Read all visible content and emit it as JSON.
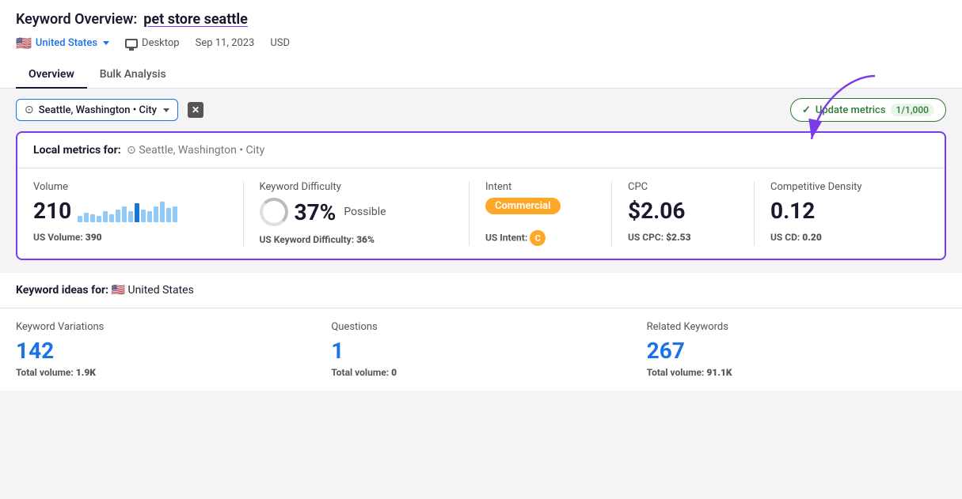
{
  "header": {
    "title_label": "Keyword Overview:",
    "title_keyword": "pet store seattle",
    "country": "United States",
    "device": "Desktop",
    "date": "Sep 11, 2023",
    "currency": "USD"
  },
  "tabs": [
    {
      "label": "Overview",
      "active": true
    },
    {
      "label": "Bulk Analysis",
      "active": false
    }
  ],
  "filter_bar": {
    "location": "Seattle, Washington",
    "location_type": "City",
    "update_button_label": "Update metrics",
    "update_count": "1/1,000"
  },
  "local_metrics": {
    "section_label": "Local metrics for:",
    "location": "Seattle, Washington",
    "location_type": "City",
    "volume": {
      "label": "Volume",
      "value": "210",
      "secondary_label": "US Volume:",
      "secondary_value": "390",
      "bars": [
        2,
        3,
        4,
        3,
        5,
        4,
        6,
        7,
        5,
        8,
        6,
        5,
        7,
        9,
        6,
        7
      ]
    },
    "keyword_difficulty": {
      "label": "Keyword Difficulty",
      "value": "37%",
      "qualifier": "Possible",
      "secondary_label": "US Keyword Difficulty:",
      "secondary_value": "36%"
    },
    "intent": {
      "label": "Intent",
      "value": "Commercial",
      "secondary_label": "US Intent:",
      "secondary_value": "C"
    },
    "cpc": {
      "label": "CPC",
      "value": "$2.06",
      "secondary_label": "US CPC:",
      "secondary_value": "$2.53"
    },
    "competitive_density": {
      "label": "Competitive Density",
      "value": "0.12",
      "secondary_label": "US CD:",
      "secondary_value": "0.20"
    }
  },
  "keyword_ideas": {
    "section_label": "Keyword ideas for:",
    "country": "United States",
    "variations": {
      "label": "Keyword Variations",
      "value": "142",
      "secondary_label": "Total volume:",
      "secondary_value": "1.9K"
    },
    "questions": {
      "label": "Questions",
      "value": "1",
      "secondary_label": "Total volume:",
      "secondary_value": "0"
    },
    "related": {
      "label": "Related Keywords",
      "value": "267",
      "secondary_label": "Total volume:",
      "secondary_value": "91.1K"
    }
  }
}
